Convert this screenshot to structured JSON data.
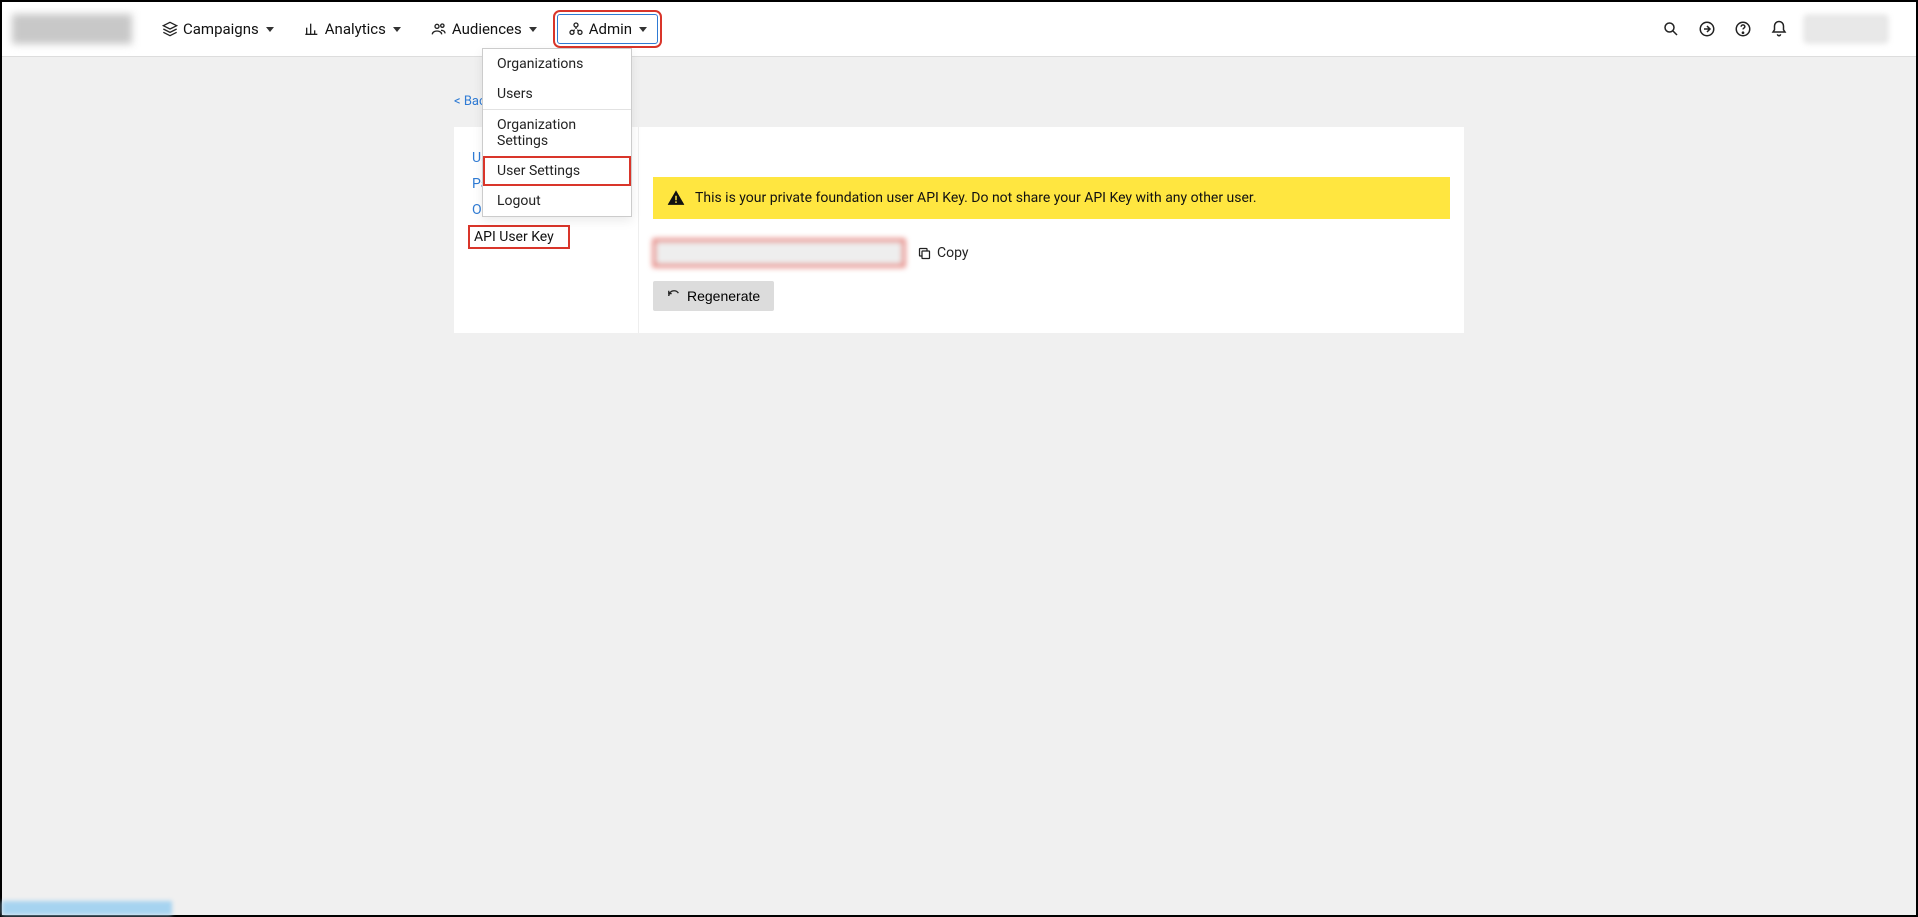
{
  "nav": {
    "campaigns": "Campaigns",
    "analytics": "Analytics",
    "audiences": "Audiences",
    "admin": "Admin"
  },
  "admin_menu": {
    "organizations": "Organizations",
    "users": "Users",
    "org_settings": "Organization Settings",
    "user_settings": "User Settings",
    "logout": "Logout"
  },
  "page": {
    "back_link": "< Back to Users",
    "tabs": {
      "user_details": "User Details",
      "password": "Password",
      "org_access": "Organization Access",
      "api_user_key": "API User Key"
    },
    "warning": "This is your private foundation user API Key. Do not share your API Key with any other user.",
    "copy_label": "Copy",
    "regenerate_label": "Regenerate"
  }
}
